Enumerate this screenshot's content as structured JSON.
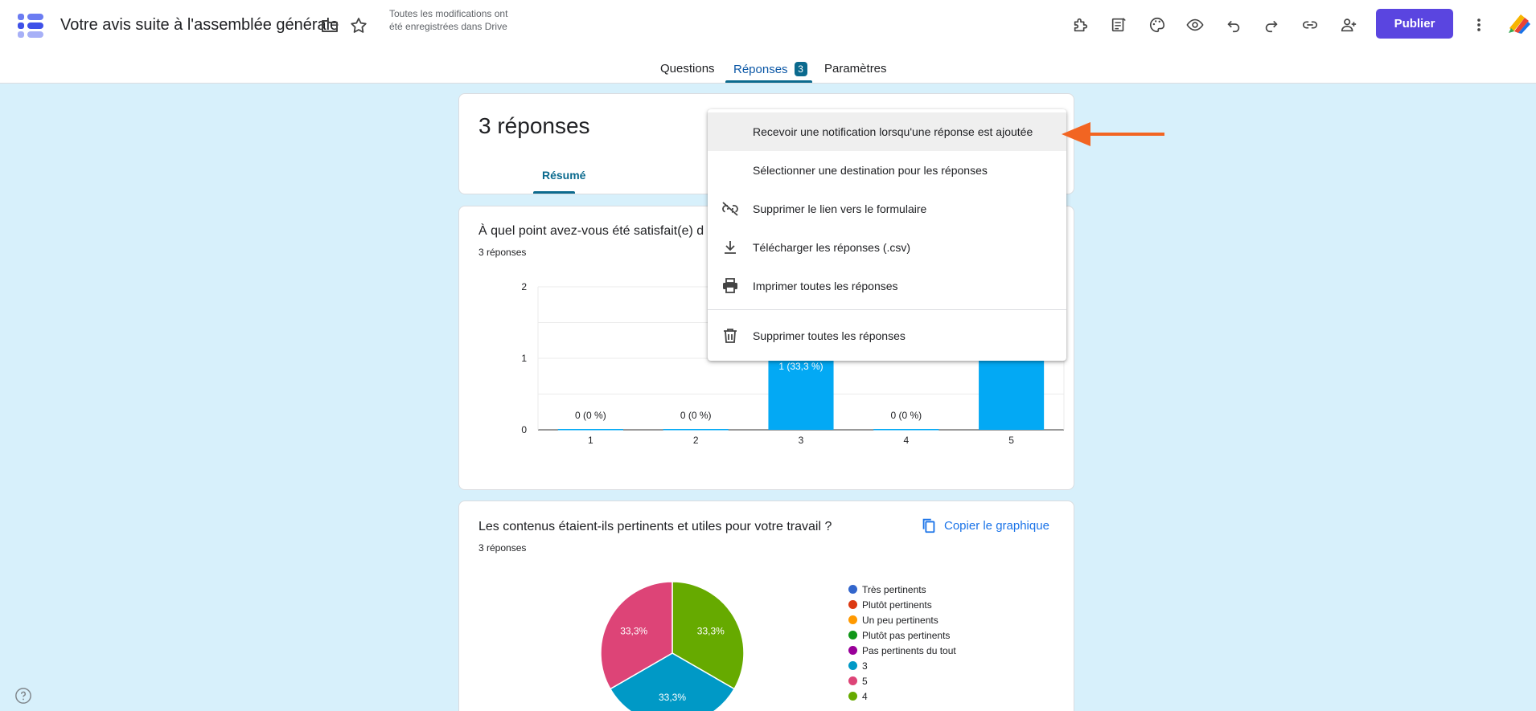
{
  "header": {
    "doc_title": "Votre avis suite à l'assemblée générale",
    "save_status": "Toutes les modifications ont été enregistrées dans Drive",
    "publish_label": "Publier"
  },
  "tabs": [
    {
      "label": "Questions"
    },
    {
      "label": "Réponses",
      "badge": "3"
    },
    {
      "label": "Paramètres"
    }
  ],
  "summary": {
    "title": "3 réponses",
    "tab_label": "Résumé"
  },
  "menu": {
    "items": [
      {
        "label": "Recevoir une notification lorsqu'une réponse est ajoutée",
        "icon": "none"
      },
      {
        "label": "Sélectionner une destination pour les réponses",
        "icon": "none"
      },
      {
        "label": "Supprimer le lien vers le formulaire",
        "icon": "link-off-icon"
      },
      {
        "label": "Télécharger les réponses (.csv)",
        "icon": "download-icon"
      },
      {
        "label": "Imprimer toutes les réponses",
        "icon": "print-icon"
      },
      {
        "label": "Supprimer toutes les réponses",
        "icon": "trash-icon"
      }
    ]
  },
  "question1": {
    "title": "À quel point avez-vous été satisfait(e) d",
    "subtitle": "3 réponses"
  },
  "question2": {
    "title": "Les contenus étaient-ils pertinents et utiles pour votre travail ?",
    "subtitle": "3 réponses",
    "copy_label": "Copier le graphique"
  },
  "chart_data": [
    {
      "type": "bar",
      "categories": [
        "1",
        "2",
        "3",
        "4",
        "5"
      ],
      "values": [
        0,
        0,
        1,
        0,
        1
      ],
      "data_labels": [
        "0 (0 %)",
        "0 (0 %)",
        "1 (33,3 %)",
        "0 (0 %)",
        ""
      ],
      "ylim": [
        0,
        2
      ],
      "yticks": [
        "0",
        "1",
        "2"
      ],
      "color": "#03a9f4",
      "grid": true
    },
    {
      "type": "pie",
      "labels": [
        "Très pertinents",
        "Plutôt pertinents",
        "Un peu pertinents",
        "Plutôt pas pertinents",
        "Pas pertinents du tout",
        "3",
        "5",
        "4"
      ],
      "colors": [
        "#3366cc",
        "#dc3912",
        "#ff9900",
        "#109618",
        "#990099",
        "#0099c6",
        "#dd4477",
        "#66aa00"
      ],
      "values": [
        0,
        0,
        0,
        0,
        0,
        1,
        1,
        1
      ],
      "slice_labels": [
        "33,3%",
        "33,3%",
        "33,3%"
      ],
      "legend_position": "right"
    }
  ],
  "colors": {
    "accent": "#0b6a8e",
    "publish": "#5a45e0",
    "arrow": "#f26522",
    "background": "#d7f0fb"
  }
}
